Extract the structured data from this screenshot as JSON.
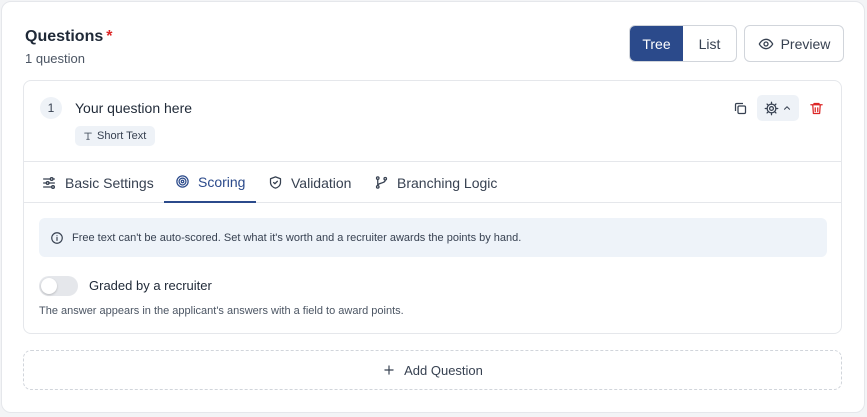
{
  "header": {
    "title": "Questions",
    "required_mark": "*",
    "count": "1 question"
  },
  "view_toggle": {
    "options": [
      "Tree",
      "List"
    ],
    "selected": "Tree"
  },
  "preview_label": "Preview",
  "question": {
    "number": "1",
    "title": "Your question here",
    "type_label": "Short Text"
  },
  "tabs": [
    {
      "label": "Basic Settings",
      "icon": "sliders-icon"
    },
    {
      "label": "Scoring",
      "icon": "target-icon"
    },
    {
      "label": "Validation",
      "icon": "shield-check-icon"
    },
    {
      "label": "Branching Logic",
      "icon": "branch-icon"
    }
  ],
  "active_tab": "Scoring",
  "info_message": "Free text can't be auto-scored. Set what it's worth and a recruiter awards the points by hand.",
  "grading": {
    "toggle_label": "Graded by a recruiter",
    "enabled": false,
    "hint": "The answer appears in the applicant's answers with a field to award points."
  },
  "add_question_label": "Add Question",
  "colors": {
    "accent": "#2b4a8b",
    "required": "#dc2626",
    "delete": "#dc2626",
    "info_bg": "#eef3f9"
  }
}
